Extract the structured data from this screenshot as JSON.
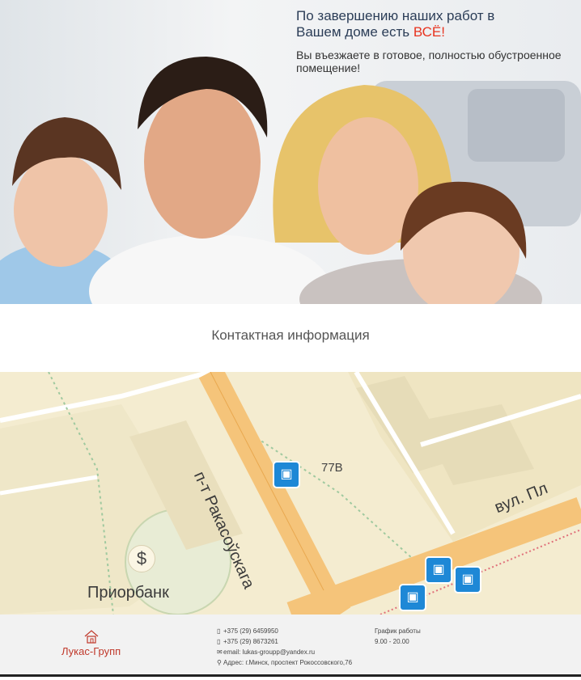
{
  "hero": {
    "title_line1": "По завершению наших работ в",
    "title_line2_prefix": "Вашем доме есть ",
    "title_accent": "ВСЁ!",
    "subtitle": "Вы въезжаете в готовое, полностью обустроенное помещение!",
    "accent_color": "#e8331f"
  },
  "contact_section": {
    "title": "Контактная информация"
  },
  "map": {
    "street_label_1": "п-т Ракасоўскага",
    "street_label_2": "вул. Пл",
    "building_label": "77В",
    "bank_label": "Приорбанк",
    "bank_icon": "dollar-icon",
    "bus_icon": "bus-stop-icon"
  },
  "footer": {
    "logo_text": "Лукас-Групп",
    "phone1": "+375 (29) 6459950",
    "phone2": "+375 (29) 8673261",
    "email": "email: lukas-groupp@yandex.ru",
    "address": "Адрес: г.Минск, проспект Рокоссовского,76",
    "schedule_label": "График работы",
    "schedule_hours": "9.00 - 20.00"
  }
}
